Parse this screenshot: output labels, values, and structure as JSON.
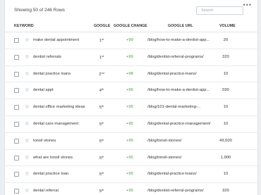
{
  "header": {
    "showing_text": "Showing 50 of 246 Rows",
    "search_placeholder": "Search",
    "more_icon": "more-dots-icon"
  },
  "columns": {
    "keyword": "KEYWORD",
    "google": "GOOGLE",
    "google_change": "GOOGLE CHANGE",
    "google_url": "GOOGLE URL",
    "volume": "VOLUME"
  },
  "colors": {
    "positive_change": "#43a047"
  },
  "rows": [
    {
      "keyword": "make dental appointment",
      "rank": "1",
      "suffix": "st",
      "change": "+99",
      "url": "/blog/how-to-make-a-dentist-app...",
      "volume": "20"
    },
    {
      "keyword": "dentist referrals",
      "rank": "1",
      "suffix": "st",
      "change": "+99",
      "url": "/blog/dentist-referral-programs/",
      "volume": "320"
    },
    {
      "keyword": "dental practice loans",
      "rank": "2",
      "suffix": "nd",
      "change": "+98",
      "url": "/blog/dental-practice-loans/",
      "volume": "10"
    },
    {
      "keyword": "dental appt",
      "rank": "4",
      "suffix": "th",
      "change": "+96",
      "url": "/blog/how-to-make-a-dentist-app...",
      "volume": "590"
    },
    {
      "keyword": "dental office marketing ideas",
      "rank": "5",
      "suffix": "th",
      "change": "+95",
      "url": "/blog/101-dental-marketing-...",
      "volume": "10"
    },
    {
      "keyword": "dental care management",
      "rank": "5",
      "suffix": "th",
      "change": "+95",
      "url": "/blog/dental-practice-management/",
      "volume": "10"
    },
    {
      "keyword": "tonsil stones",
      "rank": "5",
      "suffix": "th",
      "change": "+95",
      "url": "/blog/tonsil-stones/",
      "volume": "49,500"
    },
    {
      "keyword": "what are tonsil stones",
      "rank": "5",
      "suffix": "th",
      "change": "+95",
      "url": "/blog/tonsil-stones/",
      "volume": "1,900"
    },
    {
      "keyword": "dental practice loan",
      "rank": "5",
      "suffix": "th",
      "change": "+95",
      "url": "/blog/dental-practice-loans/",
      "volume": "10"
    },
    {
      "keyword": "dental referral",
      "rank": "5",
      "suffix": "th",
      "change": "+95",
      "url": "/blog/dentist-referral-programs/",
      "volume": "320"
    }
  ]
}
